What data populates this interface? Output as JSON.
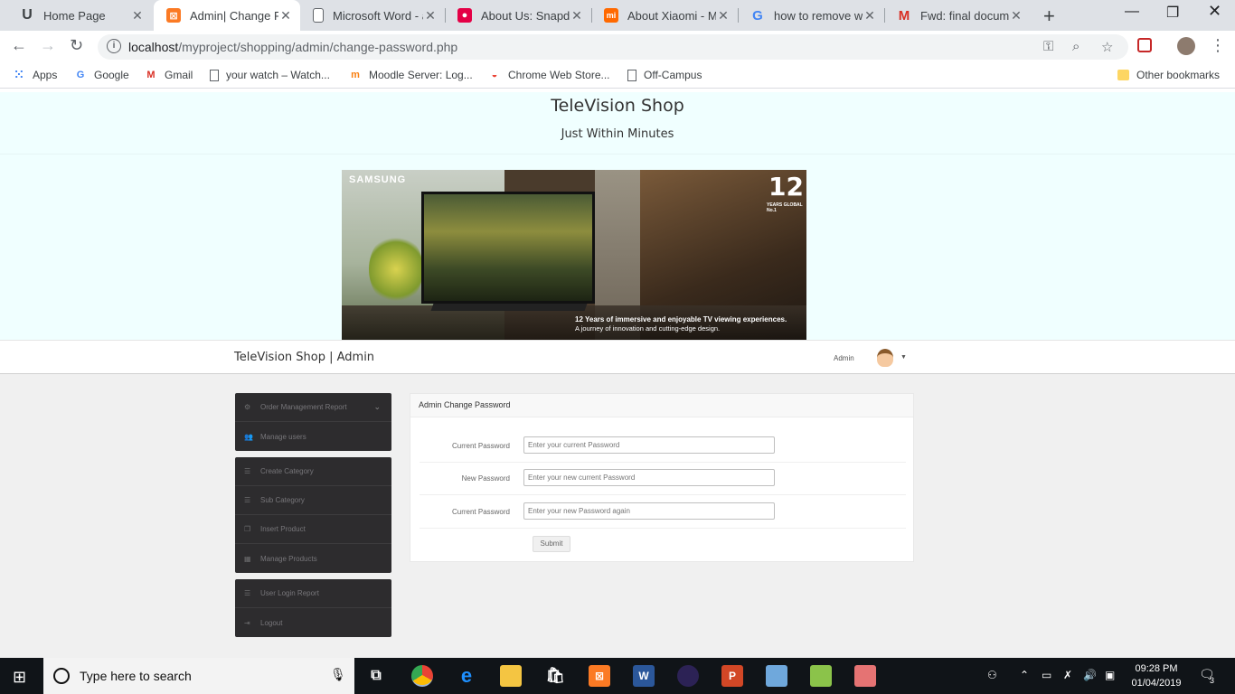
{
  "browser": {
    "tabs": [
      {
        "title": "Home Page",
        "icon": "u-icon",
        "color": "#3c4043"
      },
      {
        "title": "Admin| Change Pa",
        "icon": "xampp-icon",
        "color": "#fb7a24"
      },
      {
        "title": "Microsoft Word - a",
        "icon": "document-icon",
        "color": "#ffffff"
      },
      {
        "title": "About Us: Snapde",
        "icon": "snapdeal-icon",
        "color": "#e40046"
      },
      {
        "title": "About Xiaomi - Mi",
        "icon": "mi-icon",
        "color": "#ff6900"
      },
      {
        "title": "how to remove wa",
        "icon": "google-icon",
        "color": "#4285f4"
      },
      {
        "title": "Fwd: final docume",
        "icon": "gmail-icon",
        "color": "#d93025"
      }
    ],
    "address": {
      "host": "localhost",
      "path": "/myproject/shopping/admin/change-password.php"
    },
    "bookmarks": [
      {
        "label": "Apps",
        "icon": "apps-icon"
      },
      {
        "label": "Google",
        "icon": "google-icon"
      },
      {
        "label": "Gmail",
        "icon": "gmail-icon"
      },
      {
        "label": "your watch – Watch...",
        "icon": "page-icon"
      },
      {
        "label": "Moodle Server: Log...",
        "icon": "moodle-icon"
      },
      {
        "label": "Chrome Web Store...",
        "icon": "webstore-icon"
      },
      {
        "label": "Off-Campus",
        "icon": "page-icon"
      }
    ],
    "other_bookmarks": "Other bookmarks"
  },
  "site": {
    "title": "TeleVision Shop",
    "subtitle": "Just Within Minutes",
    "banner": {
      "brand": "SAMSUNG",
      "badge_number": "12",
      "badge_text": "YEARS GLOBAL No.1",
      "caption_line1": "12 Years of immersive and enjoyable TV viewing experiences.",
      "caption_line2": "A journey of innovation and cutting-edge design."
    }
  },
  "adminbar": {
    "brand": "TeleVision Shop | Admin",
    "user": "Admin"
  },
  "sidebar": {
    "groups": [
      [
        {
          "label": "Order Management Report",
          "icon": "gear-icon",
          "has_chevron": true
        },
        {
          "label": "Manage users",
          "icon": "users-icon"
        }
      ],
      [
        {
          "label": "Create Category",
          "icon": "list-icon"
        },
        {
          "label": "Sub Category",
          "icon": "list-icon"
        },
        {
          "label": "Insert Product",
          "icon": "copy-icon"
        },
        {
          "label": "Manage Products",
          "icon": "table-icon"
        }
      ],
      [
        {
          "label": "User Login Report",
          "icon": "list-icon"
        },
        {
          "label": "Logout",
          "icon": "logout-icon"
        }
      ]
    ]
  },
  "form": {
    "heading": "Admin Change Password",
    "fields": [
      {
        "label": "Current Password",
        "placeholder": "Enter your current Password"
      },
      {
        "label": "New Password",
        "placeholder": "Enter your new current Password"
      },
      {
        "label": "Current Password",
        "placeholder": "Enter your new Password again"
      }
    ],
    "submit": "Submit"
  },
  "taskbar": {
    "search_placeholder": "Type here to search",
    "time": "09:28 PM",
    "date": "01/04/2019",
    "notification_count": "3"
  }
}
